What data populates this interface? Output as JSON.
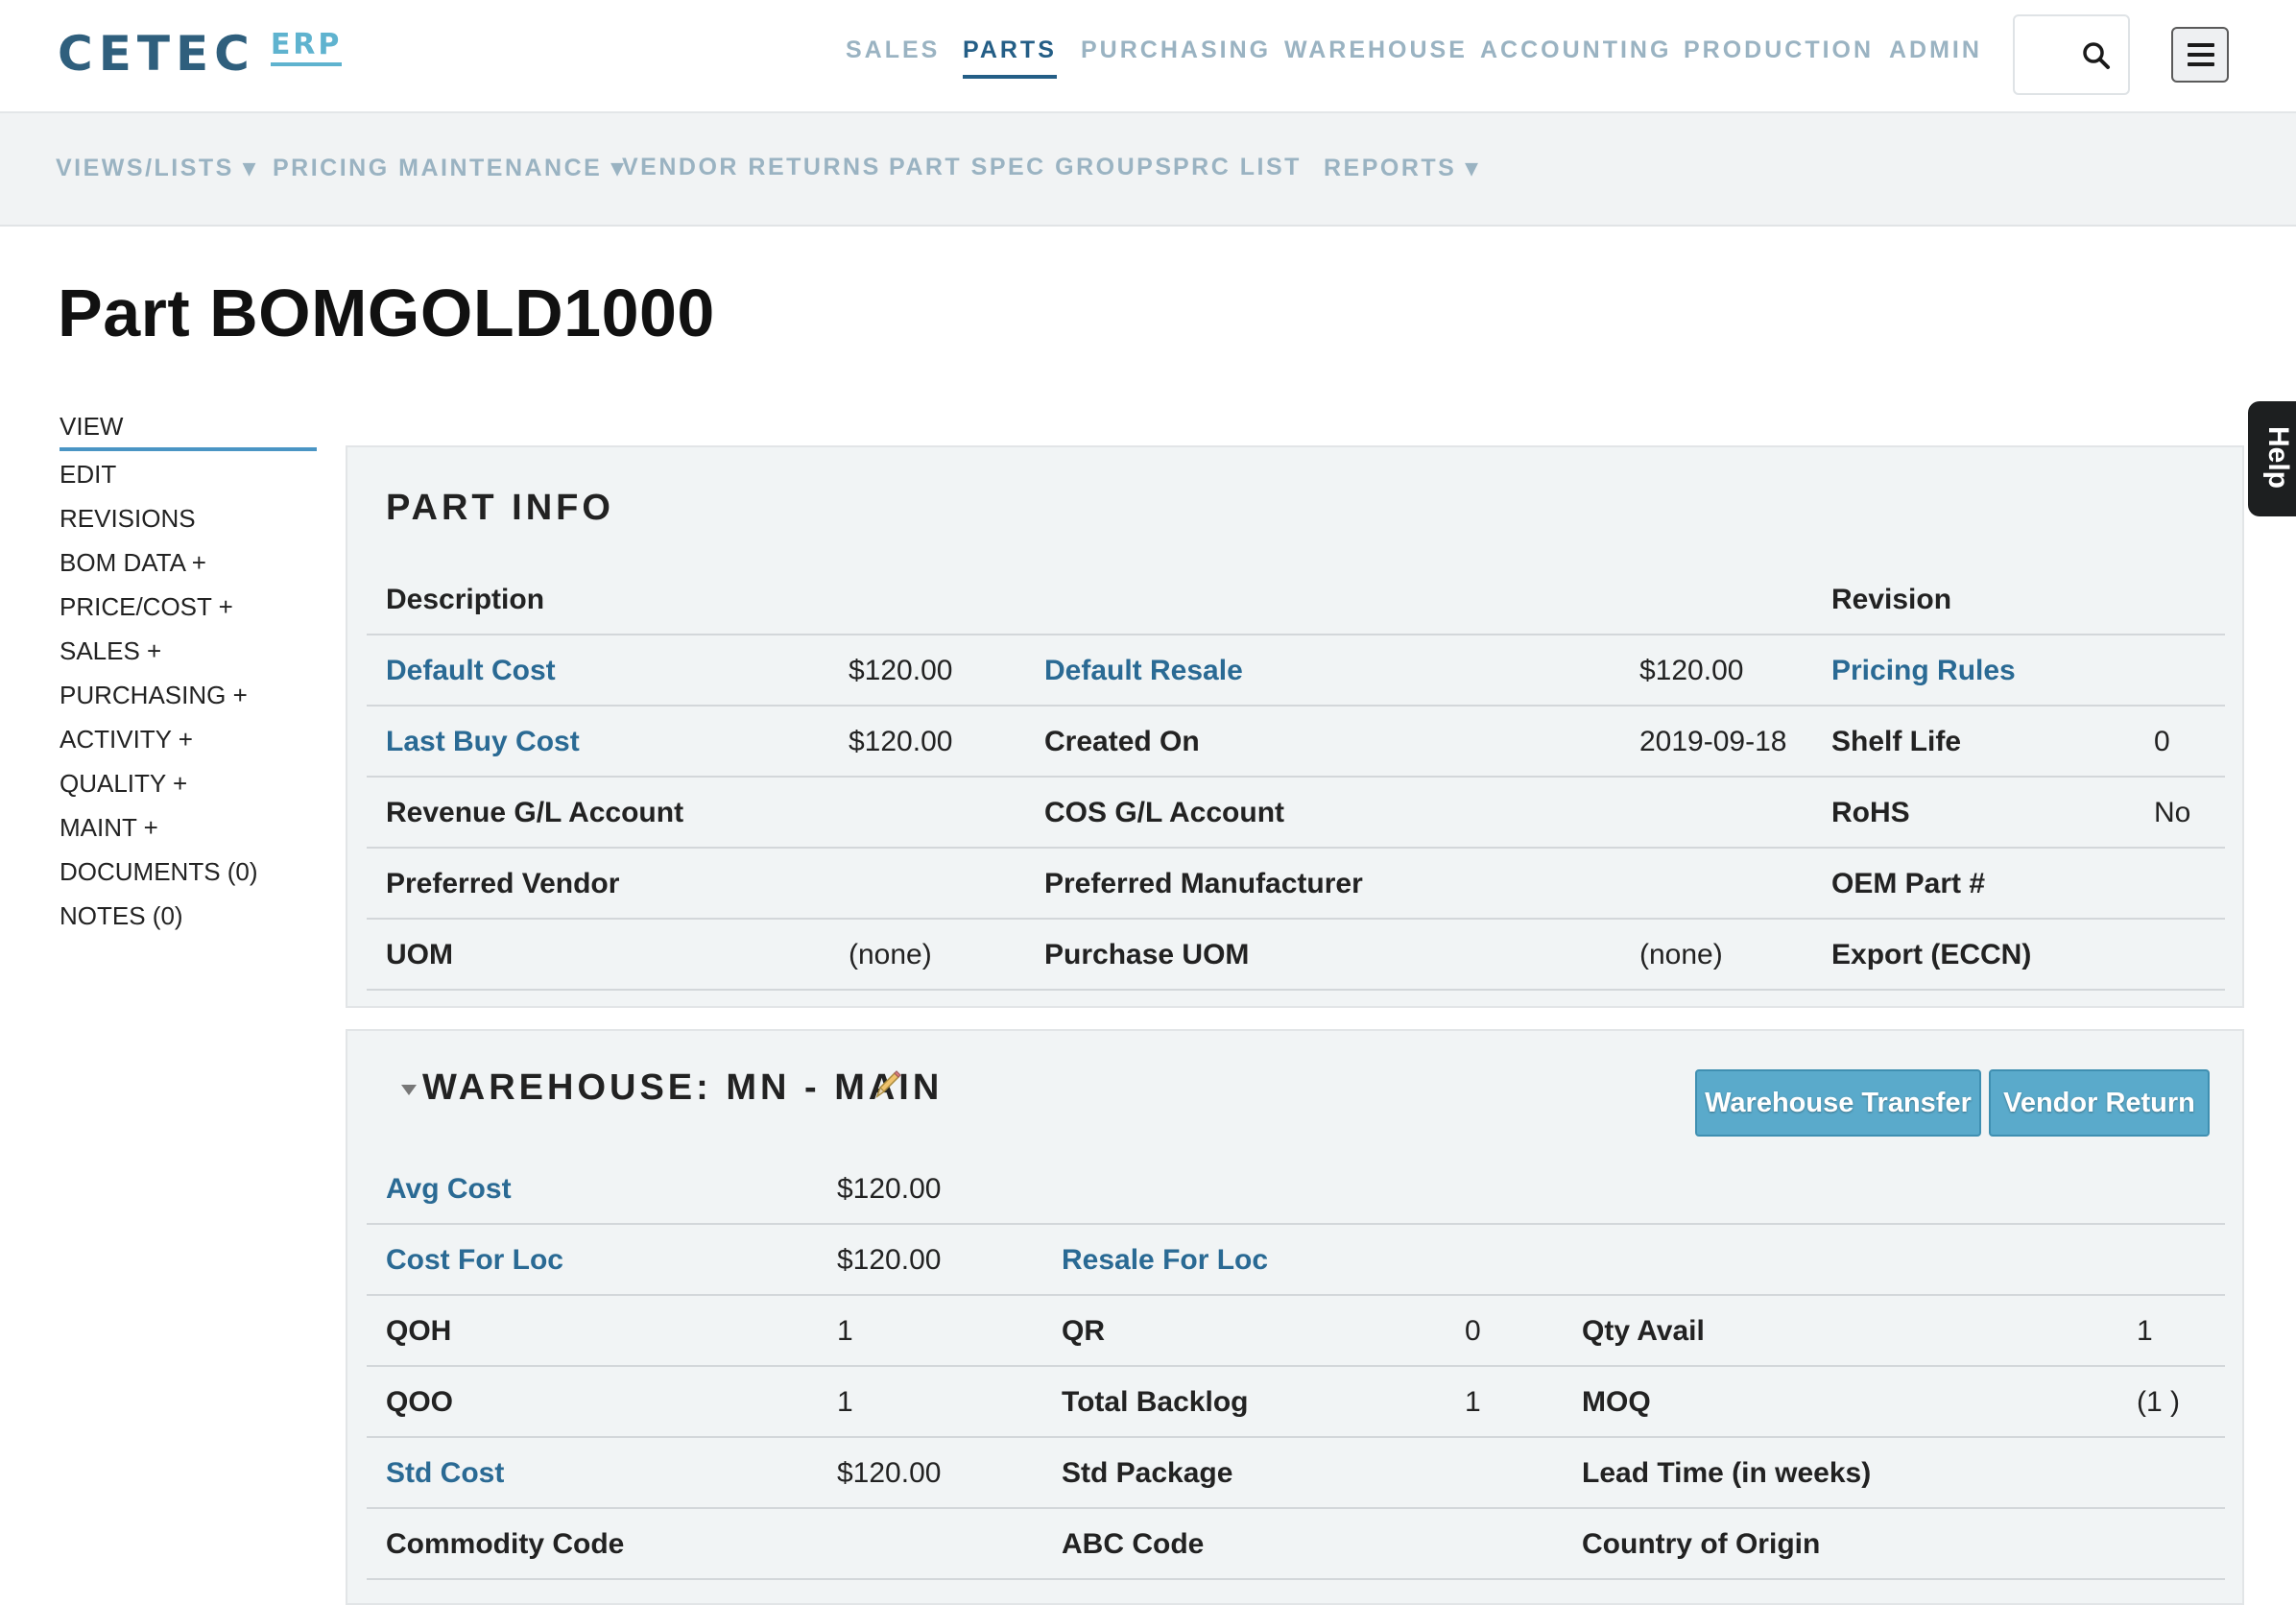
{
  "logo": {
    "main": "CETEC",
    "sub": "ERP"
  },
  "topnav": [
    "SALES",
    "PARTS",
    "PURCHASING",
    "WAREHOUSE",
    "ACCOUNTING",
    "PRODUCTION",
    "ADMIN"
  ],
  "topnav_active": "PARTS",
  "subnav": [
    "VIEWS/LISTS ▾",
    "PRICING MAINTENANCE ▾",
    "VENDOR RETURNS",
    "PART SPEC GROUPS",
    "PRC LIST",
    "REPORTS ▾"
  ],
  "page_title": "Part BOMGOLD1000",
  "sidenav": [
    "VIEW",
    "EDIT",
    "REVISIONS",
    "BOM DATA +",
    "PRICE/COST +",
    "SALES +",
    "PURCHASING +",
    "ACTIVITY +",
    "QUALITY +",
    "MAINT +",
    "DOCUMENTS (0)",
    "NOTES (0)"
  ],
  "help_label": "Help",
  "part_info": {
    "title": "PART INFO",
    "description_label": "Description",
    "revision_label": "Revision",
    "rows": [
      [
        "Default Cost",
        "$120.00",
        "Default Resale",
        "$120.00",
        "Pricing Rules",
        ""
      ],
      [
        "Last Buy Cost",
        "$120.00",
        "Created On",
        "2019-09-18",
        "Shelf Life",
        "0"
      ],
      [
        "Revenue G/L Account",
        "",
        "COS G/L Account",
        "",
        "RoHS",
        "No"
      ],
      [
        "Preferred Vendor",
        "",
        "Preferred Manufacturer",
        "",
        "OEM Part #",
        ""
      ],
      [
        "UOM",
        "(none)",
        "Purchase UOM",
        "(none)",
        "Export (ECCN)",
        ""
      ]
    ]
  },
  "warehouse": {
    "title": "WAREHOUSE: MN - MAIN",
    "buttons": [
      "Warehouse Transfer",
      "Vendor Return"
    ],
    "rows": [
      [
        "Avg Cost",
        "$120.00",
        "",
        "",
        "",
        ""
      ],
      [
        "Cost For Loc",
        "$120.00",
        "Resale For Loc",
        "",
        "",
        ""
      ],
      [
        "QOH",
        "1",
        "QR",
        "0",
        "Qty Avail",
        "1"
      ],
      [
        "QOO",
        "1",
        "Total Backlog",
        "1",
        "MOQ",
        "(1 )"
      ],
      [
        "Std Cost",
        "$120.00",
        "Std Package",
        "",
        "Lead Time (in weeks)",
        ""
      ],
      [
        "Commodity Code",
        "",
        "ABC Code",
        "",
        "Country of Origin",
        ""
      ]
    ]
  }
}
